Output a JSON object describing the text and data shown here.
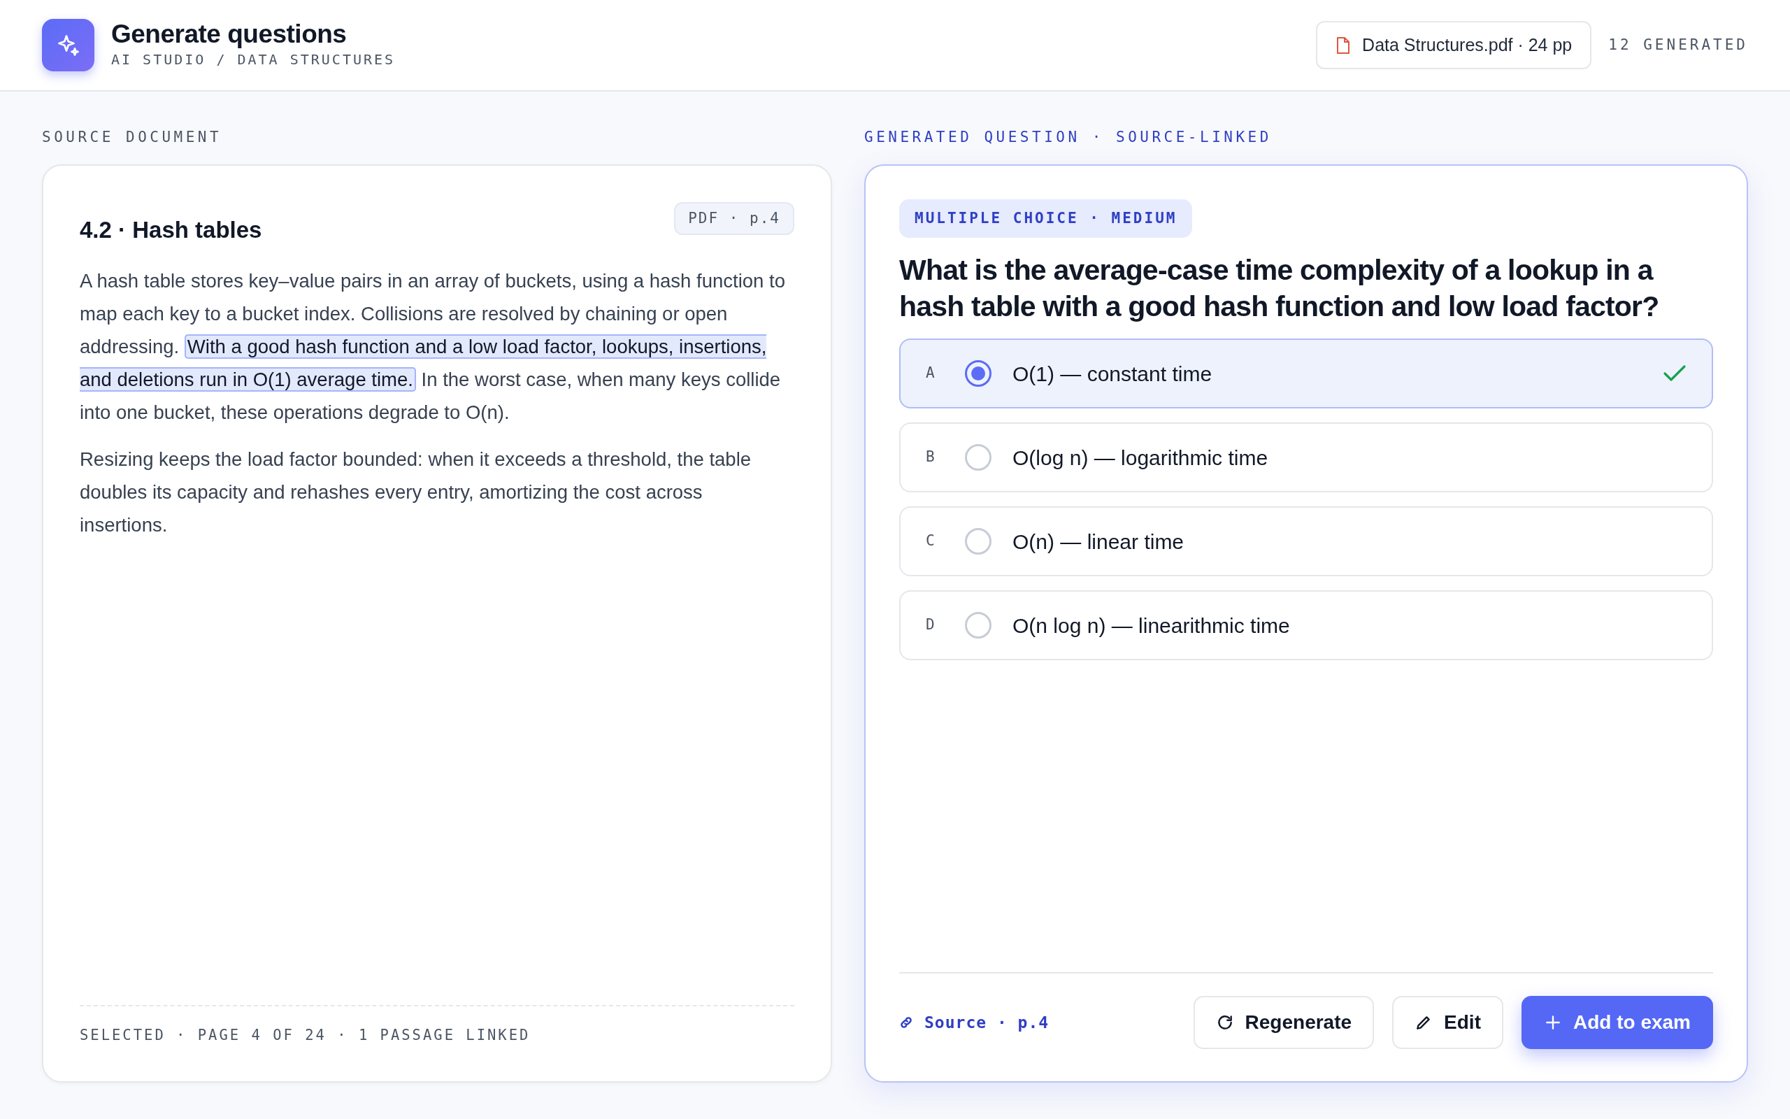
{
  "header": {
    "title": "Generate questions",
    "breadcrumb": "AI STUDIO / DATA STRUCTURES",
    "file_chip": "Data Structures.pdf · 24 pp",
    "generated_count": "12 GENERATED"
  },
  "source": {
    "section_label": "SOURCE DOCUMENT",
    "heading": "4.2 · Hash tables",
    "page_tag": "PDF · p.4",
    "paragraphs": [
      [
        {
          "text": "A hash table stores key–value pairs in an array of buckets, using a hash function to map each key to a bucket index. Collisions are resolved by chaining or open addressing. ",
          "highlighted": false
        },
        {
          "text": "With a good hash function and a low load factor, lookups, insertions, and deletions run in O(1) average time.",
          "highlighted": true
        },
        {
          "text": " In the worst case, when many keys collide into one bucket, these operations degrade to O(n).",
          "highlighted": false
        }
      ],
      [
        {
          "text": "Resizing keeps the load factor bounded: when it exceeds a threshold, the table doubles its capacity and rehashes every entry, amortizing the cost across insertions.",
          "highlighted": false
        }
      ]
    ],
    "footer": "SELECTED · PAGE 4 OF 24 · 1 PASSAGE LINKED"
  },
  "question": {
    "section_label": "GENERATED QUESTION · SOURCE-LINKED",
    "tag": "MULTIPLE CHOICE · MEDIUM",
    "text": "What is the average-case time complexity of a lookup in a hash table with a good hash function and low load factor?",
    "options": [
      {
        "letter": "A",
        "text": "O(1) — constant time",
        "selected": true,
        "correct": true
      },
      {
        "letter": "B",
        "text": "O(log n) — logarithmic time",
        "selected": false,
        "correct": false
      },
      {
        "letter": "C",
        "text": "O(n) — linear time",
        "selected": false,
        "correct": false
      },
      {
        "letter": "D",
        "text": "O(n log n) — linearithmic time",
        "selected": false,
        "correct": false
      }
    ],
    "source_link": "Source · p.4",
    "buttons": [
      {
        "label": "Regenerate",
        "kind": "regenerate"
      },
      {
        "label": "Edit",
        "kind": "edit"
      },
      {
        "label": "Add to exam",
        "kind": "add"
      }
    ]
  }
}
